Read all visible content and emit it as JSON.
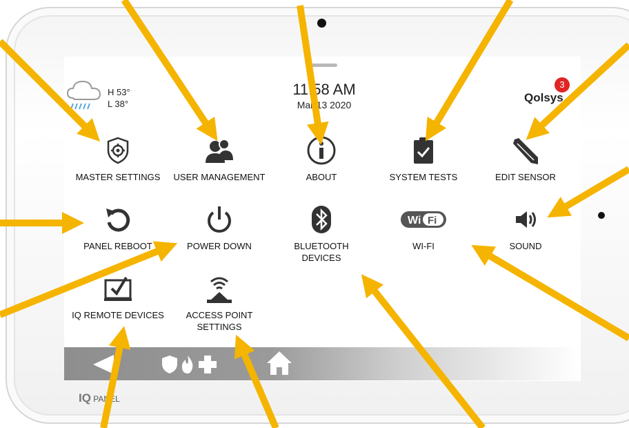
{
  "weather": {
    "high": "H 53°",
    "low": "L 38°"
  },
  "clock": {
    "time": "11:58 AM",
    "date": "Mar 13 2020"
  },
  "brand": {
    "logo_text": "Qolsys",
    "notification_count": "3"
  },
  "tiles": [
    {
      "label": "MASTER SETTINGS",
      "icon": "shield-gear-icon"
    },
    {
      "label": "USER MANAGEMENT",
      "icon": "users-icon"
    },
    {
      "label": "ABOUT",
      "icon": "info-icon"
    },
    {
      "label": "SYSTEM TESTS",
      "icon": "clipboard-check-icon"
    },
    {
      "label": "EDIT SENSOR",
      "icon": "pencil-icon"
    },
    {
      "label": "PANEL REBOOT",
      "icon": "reboot-icon"
    },
    {
      "label": "POWER DOWN",
      "icon": "power-icon"
    },
    {
      "label": "BLUETOOTH\nDEVICES",
      "icon": "bluetooth-icon"
    },
    {
      "label": "WI-FI",
      "icon": "wifi-logo-icon"
    },
    {
      "label": "SOUND",
      "icon": "speaker-icon"
    },
    {
      "label": "IQ REMOTE DEVICES",
      "icon": "tablet-check-icon"
    },
    {
      "label": "ACCESS POINT\nSETTINGS",
      "icon": "router-icon"
    }
  ],
  "navbar": {
    "icons": [
      "back-icon",
      "shield-icon",
      "fire-icon",
      "medical-cross-icon",
      "home-icon"
    ]
  },
  "footer": {
    "brand_prefix": "IQ",
    "brand_suffix": "PANEL"
  },
  "colors": {
    "arrow": "#f5b400",
    "badge": "#e02424",
    "icon": "#333333"
  }
}
